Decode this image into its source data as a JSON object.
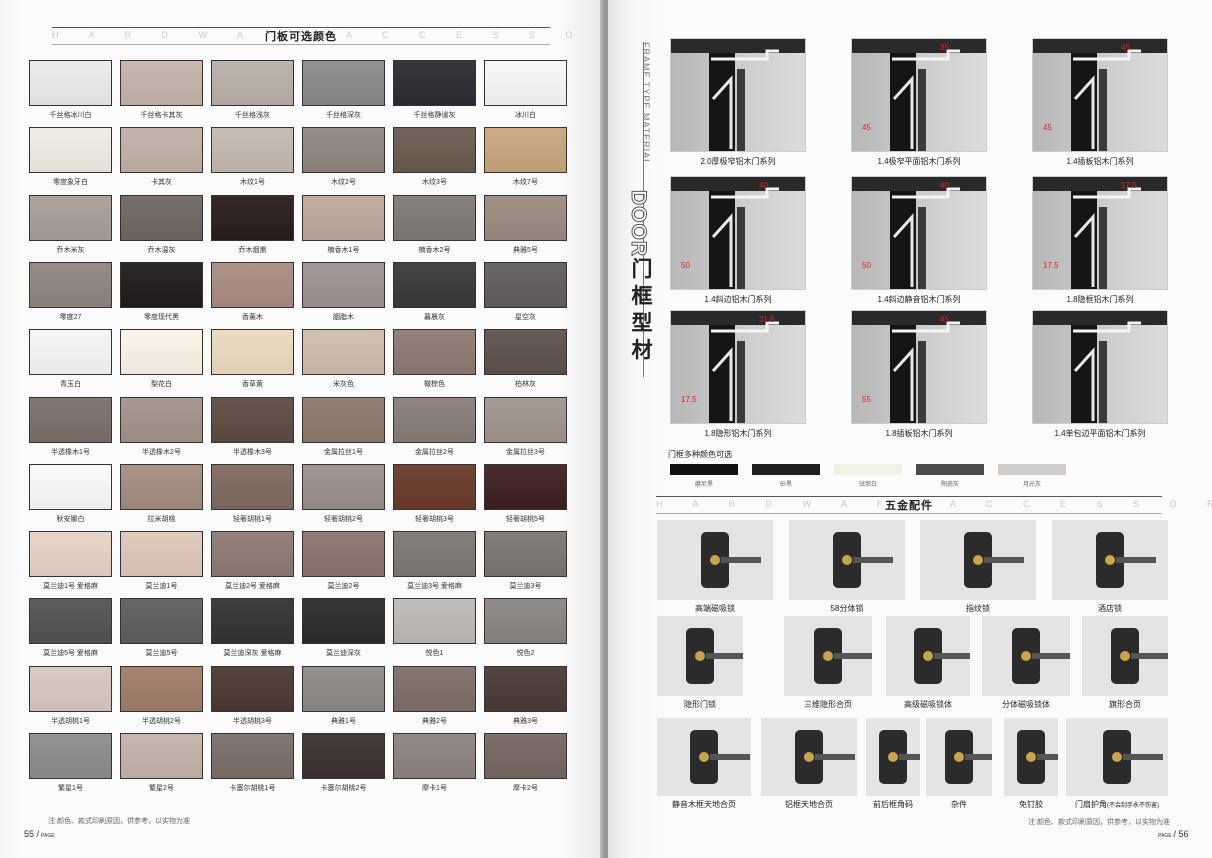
{
  "left": {
    "header_ghost": "H A R D W A R E   A C C E S S O R I E S",
    "title": "门板可选颜色",
    "swatches": [
      {
        "label": "千丝格冰川白",
        "color": "#ebebeb"
      },
      {
        "label": "千丝格卡其灰",
        "color": "#c4b3a9"
      },
      {
        "label": "千丝格浅灰",
        "color": "#b9b0a7"
      },
      {
        "label": "千丝格深灰",
        "color": "#8c8a88"
      },
      {
        "label": "千丝格静谧灰",
        "color": "#2b2b31"
      },
      {
        "label": "冰川白",
        "color": "#f7f7f7"
      },
      {
        "label": "零度象牙白",
        "color": "#f0ece3"
      },
      {
        "label": "卡其灰",
        "color": "#c2b0a6"
      },
      {
        "label": "木纹1号",
        "color": "#c5b9ae"
      },
      {
        "label": "木纹2号",
        "color": "#8e8780"
      },
      {
        "label": "木纹3号",
        "color": "#6a5b4e"
      },
      {
        "label": "木纹7号",
        "color": "#c9a57f"
      },
      {
        "label": "乔木米灰",
        "color": "#a89f97"
      },
      {
        "label": "乔木温灰",
        "color": "#6e6661"
      },
      {
        "label": "乔木烟熏",
        "color": "#2a1c1c"
      },
      {
        "label": "楠香木1号",
        "color": "#bca99d"
      },
      {
        "label": "楠香木2号",
        "color": "#7f7a77"
      },
      {
        "label": "典雅5号",
        "color": "#9b8a7f"
      },
      {
        "label": "零度27",
        "color": "#8f8580"
      },
      {
        "label": "零度现代黑",
        "color": "#1f1b1b"
      },
      {
        "label": "香薰木",
        "color": "#a88d80"
      },
      {
        "label": "胭脂木",
        "color": "#9e9291"
      },
      {
        "label": "暮晨灰",
        "color": "#3a383b"
      },
      {
        "label": "星空灰",
        "color": "#615d5d"
      },
      {
        "label": "青玉白",
        "color": "#f6f6f4"
      },
      {
        "label": "梨花白",
        "color": "#fbf5e6"
      },
      {
        "label": "香草黄",
        "color": "#ecd9c0"
      },
      {
        "label": "米灰色",
        "color": "#cfbcac"
      },
      {
        "label": "橄棕色",
        "color": "#8e7a70"
      },
      {
        "label": "柏林灰",
        "color": "#5e514b"
      },
      {
        "label": "半透橡木1号",
        "color": "#7c6f6a"
      },
      {
        "label": "半透橡木2号",
        "color": "#a2928a"
      },
      {
        "label": "半透橡木3号",
        "color": "#5e4b41"
      },
      {
        "label": "金属拉丝1号",
        "color": "#8d796d"
      },
      {
        "label": "金属拉丝2号",
        "color": "#887d77"
      },
      {
        "label": "金属拉丝3号",
        "color": "#a0958c"
      },
      {
        "label": "秋安娜白",
        "color": "#fafafa"
      },
      {
        "label": "拉米胡桃",
        "color": "#a48d81"
      },
      {
        "label": "轻奢胡桃1号",
        "color": "#7f6a5e"
      },
      {
        "label": "轻奢胡桃2号",
        "color": "#9c8f8a"
      },
      {
        "label": "轻奢胡桃3号",
        "color": "#6b3a2a"
      },
      {
        "label": "轻奢胡桃5号",
        "color": "#3e1f1f"
      },
      {
        "label": "莫兰迪1号 爱格麻",
        "color": "#e7d3c6"
      },
      {
        "label": "莫兰迪1号",
        "color": "#dfc7ba"
      },
      {
        "label": "莫兰迪2号 爱格麻",
        "color": "#8f7a72"
      },
      {
        "label": "莫兰迪2号",
        "color": "#8b746c"
      },
      {
        "label": "莫兰迪3号 爱格麻",
        "color": "#7c7874"
      },
      {
        "label": "莫兰迪3号",
        "color": "#7a7673"
      },
      {
        "label": "莫兰迪5号 爱格麻",
        "color": "#545353"
      },
      {
        "label": "莫兰迪5号",
        "color": "#5f5e5e"
      },
      {
        "label": "莫兰迪深灰 爱格麻",
        "color": "#333235"
      },
      {
        "label": "莫兰迪深灰",
        "color": "#2b2a2c"
      },
      {
        "label": "悦色1",
        "color": "#bdb9b6"
      },
      {
        "label": "悦色2",
        "color": "#8a8582"
      },
      {
        "label": "半透胡桃1号",
        "color": "#d7c7bf"
      },
      {
        "label": "半透胡桃2号",
        "color": "#a07d6a"
      },
      {
        "label": "半透胡桃3号",
        "color": "#4c3830"
      },
      {
        "label": "典雅1号",
        "color": "#8f8986"
      },
      {
        "label": "典雅2号",
        "color": "#7f6e68"
      },
      {
        "label": "典雅3号",
        "color": "#4a3b35"
      },
      {
        "label": "繁星1号",
        "color": "#8d8c8d"
      },
      {
        "label": "繁星2号",
        "color": "#c3b2a8"
      },
      {
        "label": "卡塞尔胡桃1号",
        "color": "#7b6e69"
      },
      {
        "label": "卡塞尔胡桃2号",
        "color": "#3a3130"
      },
      {
        "label": "摩卡1号",
        "color": "#8c8380"
      },
      {
        "label": "摩卡2号",
        "color": "#756761"
      }
    ],
    "note": "注:颜色、款式印刷原因，供参考，以实物为准",
    "page_num": "55",
    "page_word": "PAGE"
  },
  "right": {
    "vertical_en": "FRAME TYPE MATERIAL",
    "vertical_door": "DOOR",
    "vertical_cn": [
      "门",
      "框",
      "型",
      "材"
    ],
    "profiles": [
      {
        "label": "2.0厚极窄铝木门系列",
        "dims": [
          "",
          ""
        ]
      },
      {
        "label": "1.4极窄平面铝木门系列",
        "dims": [
          "35",
          "45"
        ]
      },
      {
        "label": "1.4插板铝木门系列",
        "dims": [
          "45",
          "45"
        ]
      },
      {
        "label": "1.4斜边铝木门系列",
        "dims": [
          "40",
          "50"
        ]
      },
      {
        "label": "1.4斜边静音铝木门系列",
        "dims": [
          "40",
          "50"
        ]
      },
      {
        "label": "1.8隐框铝木门系列",
        "dims": [
          "17.5",
          "17.5"
        ]
      },
      {
        "label": "1.8隐形铝木门系列",
        "dims": [
          "31.5",
          "17.5"
        ]
      },
      {
        "label": "1.8插板铝木门系列",
        "dims": [
          "45",
          "55"
        ]
      },
      {
        "label": "1.4单包边平面铝木门系列",
        "dims": [
          "",
          ""
        ]
      }
    ],
    "frame_color_title": "门框多种颜色可选",
    "frame_colors": [
      {
        "label": "磨尼黑",
        "color": "#111111"
      },
      {
        "label": "砂黑",
        "color": "#1f1f1f"
      },
      {
        "label": "琺琅白",
        "color": "#f1f2e6"
      },
      {
        "label": "陶瓷灰",
        "color": "#4d4b4b"
      },
      {
        "label": "月光灰",
        "color": "#cfccc9"
      }
    ],
    "hw_ghost": "H A R D W A R E   A C C E S S O R I E S",
    "hw_title": "五金配件",
    "hardware": [
      {
        "label": "高端磁吸锁",
        "sub": ""
      },
      {
        "label": "58分体锁",
        "sub": ""
      },
      {
        "label": "指纹锁",
        "sub": ""
      },
      {
        "label": "酒店锁",
        "sub": ""
      },
      {
        "label": "隐形门锁",
        "sub": ""
      },
      {
        "label": "三维隐形合页",
        "sub": ""
      },
      {
        "label": "高级磁吸锁体",
        "sub": ""
      },
      {
        "label": "分体磁吸锁体",
        "sub": ""
      },
      {
        "label": "旗形合页",
        "sub": ""
      },
      {
        "label": "静音木框天地合页",
        "sub": ""
      },
      {
        "label": "铝框天地合页",
        "sub": ""
      },
      {
        "label": "前后框角码",
        "sub": ""
      },
      {
        "label": "杂件",
        "sub": ""
      },
      {
        "label": "免钉胶",
        "sub": ""
      },
      {
        "label": "门扇护角",
        "sub": "(不会刮手永不伤害)"
      }
    ],
    "note": "注:颜色、款式印刷原因，供参考，以实物为准",
    "page_num": "56",
    "page_word": "PAGE"
  }
}
